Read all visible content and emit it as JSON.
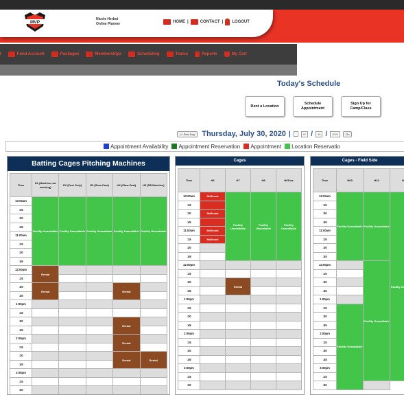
{
  "header": {
    "site_title_line1": "Nicole Herbst",
    "site_title_line2": "Online Planner",
    "logo_text": "MVP",
    "links": [
      "HOME",
      "CONTACT",
      "LOGOUT"
    ]
  },
  "nav": {
    "items": [
      "nt",
      "Fund Account",
      "Packages",
      "Memberships",
      "Scheduling",
      "Teams",
      "Reports",
      "My Cart"
    ]
  },
  "page": {
    "title": "Today's Schedule",
    "buttons": [
      "Rent a Location",
      "Schedule Appointment",
      "Sign Up for Camp/Class"
    ]
  },
  "datebar": {
    "prev_day": "<< Prev Day",
    "date": "Thursday, July 30, 2020",
    "month": "07",
    "day": "30",
    "year": "2020",
    "go": "Go"
  },
  "legend": [
    {
      "label": "Appointment Availability",
      "color": "#1f3fd6"
    },
    {
      "label": "Appointment Reservation",
      "color": "#1d7a22"
    },
    {
      "label": "Appointment",
      "color": "#d92d22"
    },
    {
      "label": "Location Reservatio",
      "color": "#43c54a"
    }
  ],
  "labels": {
    "facility_unavailable": "Facility Unavailable",
    "rental": "Rental",
    "mcbrook": "McBrook",
    "time": "Time"
  },
  "times": [
    "10:00am",
    ":15",
    ":30",
    ":45",
    "11:00am",
    ":15",
    ":30",
    ":45",
    "12:00pm",
    ":15",
    ":30",
    ":45",
    "1:00pm",
    ":15",
    ":30",
    ":45",
    "2:00pm",
    ":15",
    ":30",
    ":45",
    "3:00pm",
    ":15",
    ":30"
  ],
  "panels": [
    {
      "title": "Batting Cages Pitching Machines",
      "columns": [
        "H1 (Machine not working)",
        "H2 (Fast Only)",
        "H3 (Slow-Fast)",
        "H4 (Slow-Fast)",
        "H5 (SB Machine)"
      ]
    },
    {
      "title": "Cages",
      "columns": [
        "H6",
        "H7",
        "H8",
        "H9Trax"
      ]
    },
    {
      "title": "Cages - Field Side",
      "columns": [
        "H09",
        "H10",
        "H1"
      ]
    }
  ]
}
